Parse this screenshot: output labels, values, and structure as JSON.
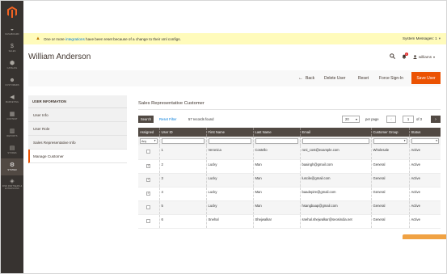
{
  "sidebar": {
    "logo_icon": "magento-logo-icon",
    "items": [
      {
        "label": "Dashboard",
        "icon": "dashboard-icon",
        "glyph": "◒"
      },
      {
        "label": "Sales",
        "icon": "dollar-icon",
        "glyph": "$"
      },
      {
        "label": "Catalog",
        "icon": "cube-icon",
        "glyph": "⬢"
      },
      {
        "label": "Customers",
        "icon": "person-icon",
        "glyph": "☻"
      },
      {
        "label": "Marketing",
        "icon": "megaphone-icon",
        "glyph": "◀"
      },
      {
        "label": "Content",
        "icon": "layout-icon",
        "glyph": "▦"
      },
      {
        "label": "Reports",
        "icon": "bar-chart-icon",
        "glyph": "▥"
      },
      {
        "label": "Stores",
        "icon": "store-icon",
        "glyph": "▤"
      },
      {
        "label": "System",
        "icon": "gear-icon",
        "glyph": "⚙"
      },
      {
        "label": "Find Partners & Extensions",
        "icon": "puzzle-icon",
        "glyph": "◈"
      }
    ]
  },
  "notice": {
    "text_before": "One or more ",
    "link": "integrations",
    "text_after": " have been reset because of a change to their xml configs.",
    "system_messages": "System Messages: 1"
  },
  "header": {
    "title": "William Anderson",
    "notifications_count": "1",
    "user_name": "williams"
  },
  "toolbar": {
    "back": "Back",
    "delete": "Delete User",
    "reset": "Reset",
    "force_signin": "Force Sign-In",
    "save": "Save User"
  },
  "tabs": {
    "heading": "USER INFORMATION",
    "items": [
      "User Info",
      "User Role",
      "Sales Representative Info",
      "Manage Customer"
    ]
  },
  "section": {
    "title": "Sales Representative Customer"
  },
  "grid_controls": {
    "search": "Search",
    "reset_filter": "Reset Filter",
    "records": "57 records found",
    "per_page_value": "20",
    "per_page_label": "per page",
    "page": "1",
    "of_pages": "of 3"
  },
  "grid": {
    "columns": [
      "Assigned",
      "User ID",
      "First Name",
      "Last Name",
      "Email",
      "Customer Group",
      "Status"
    ],
    "assigned_filter": "Any",
    "rows": [
      {
        "assigned": false,
        "id": "1",
        "first": "Veronica",
        "last": "Costello",
        "email": "roni_cost@example.com",
        "group": "Wholesale",
        "status": "Active"
      },
      {
        "assigned": true,
        "id": "2",
        "first": "Lucky",
        "last": "Man",
        "email": "baaingh@gmail.com",
        "group": "General",
        "status": "Active"
      },
      {
        "assigned": true,
        "id": "3",
        "first": "Lucky",
        "last": "Man",
        "email": "luscile@gmail.com",
        "group": "General",
        "status": "Active"
      },
      {
        "assigned": true,
        "id": "4",
        "first": "Lucky",
        "last": "Man",
        "email": "baadepire@gmail.com",
        "group": "General",
        "status": "Active"
      },
      {
        "assigned": false,
        "id": "5",
        "first": "Lucky",
        "last": "Man",
        "email": "hsangbaap@gmail.com",
        "group": "General",
        "status": "Active"
      },
      {
        "assigned": false,
        "id": "6",
        "first": "Snehal",
        "last": "Shejwalkar",
        "email": "snehal.shejwalkar@seosindia.net",
        "group": "General",
        "status": "Active"
      }
    ]
  },
  "colors": {
    "sidebar_bg": "#373330",
    "accent": "#eb5202",
    "grid_header": "#514943",
    "notice_bg": "#fffbbb",
    "link": "#007bdb"
  }
}
